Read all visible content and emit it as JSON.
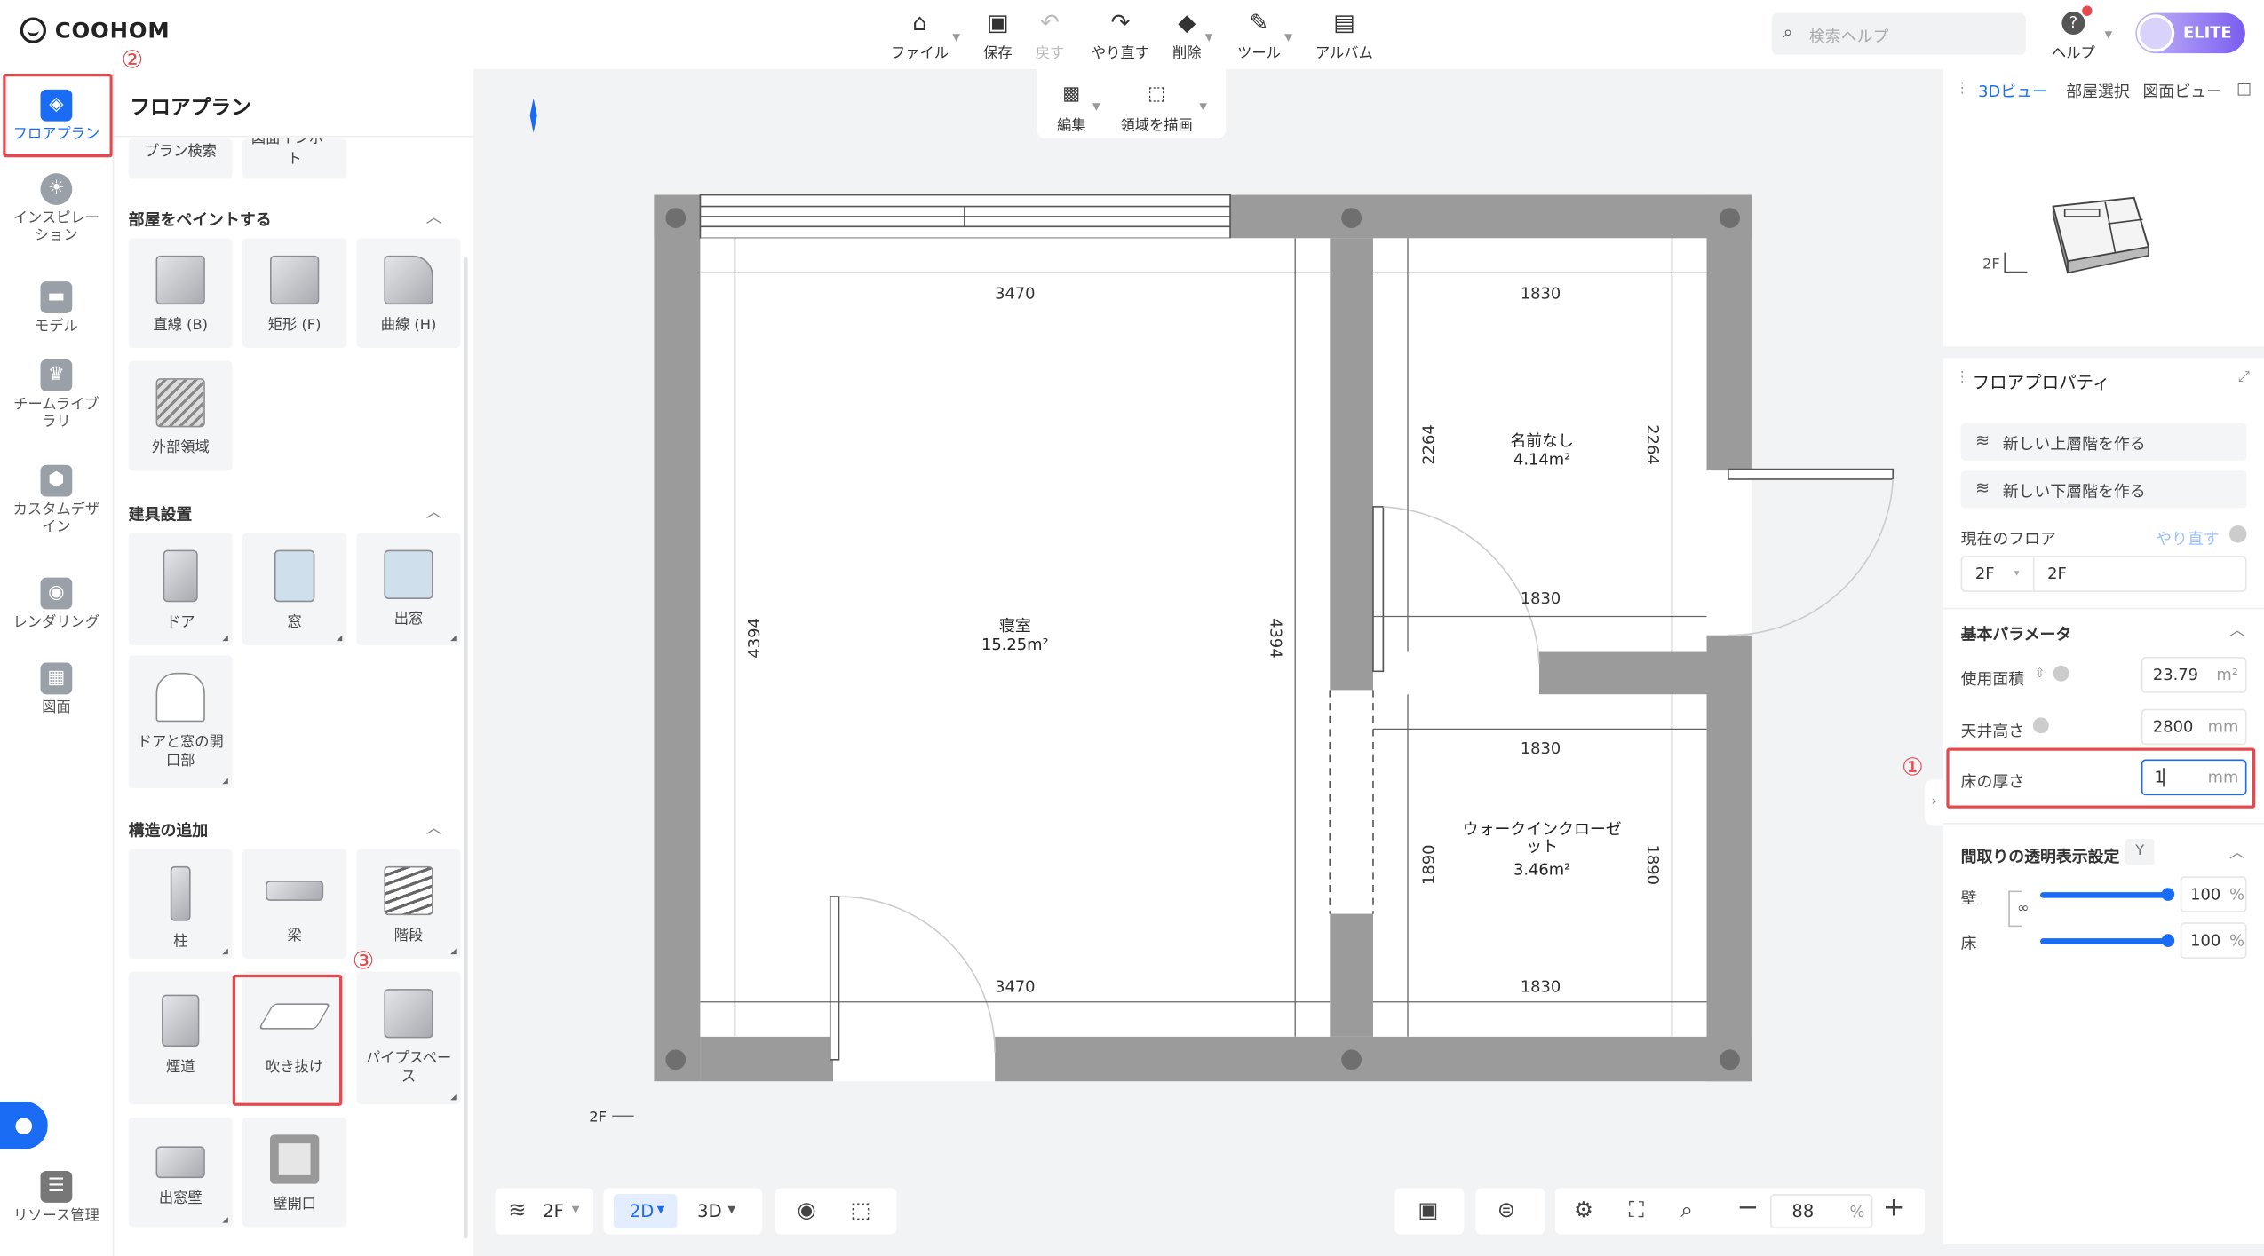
{
  "app": {
    "logo": "COOHOM"
  },
  "toolbar": {
    "items": [
      {
        "label": "ファイル",
        "icon": "home-icon",
        "dropdown": true,
        "disabled": false
      },
      {
        "label": "保存",
        "icon": "save-icon",
        "dropdown": false,
        "disabled": false
      },
      {
        "label": "戻す",
        "icon": "undo-icon",
        "dropdown": false,
        "disabled": true
      },
      {
        "label": "やり直す",
        "icon": "redo-icon",
        "dropdown": false,
        "disabled": false
      },
      {
        "label": "削除",
        "icon": "eraser-icon",
        "dropdown": true,
        "disabled": false
      },
      {
        "label": "ツール",
        "icon": "wrench-icon",
        "dropdown": true,
        "disabled": false
      },
      {
        "label": "アルバム",
        "icon": "album-icon",
        "dropdown": false,
        "disabled": false
      }
    ]
  },
  "search": {
    "placeholder": "検索ヘルプ"
  },
  "help": {
    "label": "ヘルプ"
  },
  "user": {
    "badge": "ELITE"
  },
  "leftnav": {
    "items": [
      {
        "label": "フロアプラン",
        "icon": "floorplan-icon",
        "active": true
      },
      {
        "label": "インスピレーション",
        "icon": "lightbulb-icon",
        "active": false
      },
      {
        "label": "モデル",
        "icon": "sofa-icon",
        "active": false
      },
      {
        "label": "チームライブラリ",
        "icon": "crown-icon",
        "active": false
      },
      {
        "label": "カスタムデザイン",
        "icon": "custom-design-icon",
        "active": false
      },
      {
        "label": "レンダリング",
        "icon": "camera-icon",
        "active": false
      },
      {
        "label": "図面",
        "icon": "drawing-icon",
        "active": false
      },
      {
        "label": "リソース管理",
        "icon": "resource-icon",
        "active": false
      }
    ]
  },
  "panel": {
    "title": "フロアプラン",
    "top_cards": [
      "プラン検索",
      "図面インポート"
    ],
    "sections": [
      {
        "title": "部屋をペイントする",
        "cards": [
          "直線 (B)",
          "矩形 (F)",
          "曲線 (H)",
          "外部領域"
        ]
      },
      {
        "title": "建具設置",
        "cards": [
          "ドア",
          "窓",
          "出窓",
          "ドアと窓の開口部"
        ]
      },
      {
        "title": "構造の追加",
        "cards": [
          "柱",
          "梁",
          "階段",
          "煙道",
          "吹き抜け",
          "パイプスペース",
          "出窓壁",
          "壁開口"
        ]
      }
    ]
  },
  "annotations": {
    "one": "①",
    "two": "②",
    "three": "③"
  },
  "canvas_tools": {
    "edit": "編集",
    "draw_region": "領域を描画"
  },
  "floorplan": {
    "floor_label": "2F",
    "rooms": [
      {
        "name": "寝室",
        "area": "15.25m²"
      },
      {
        "name": "名前なし",
        "area": "4.14m²"
      },
      {
        "name": "ウォークインクローゼット",
        "area": "3.46m²"
      }
    ],
    "dims": {
      "bed_top": "3470",
      "bed_bottom": "3470",
      "bed_left": "4394",
      "bed_right": "4394",
      "top_right_top": "1830",
      "top_right_bottom": "1830",
      "top_right_left": "2264",
      "top_right_right": "2264",
      "wic_top": "1830",
      "wic_bottom": "1830",
      "wic_left": "1890",
      "wic_right": "1890"
    }
  },
  "bottombar": {
    "floor": "2F",
    "mode2d": "2D",
    "mode3d": "3D",
    "zoom": "88",
    "zoom_unit": "%"
  },
  "rightpanel": {
    "tabs": [
      "3Dビュー",
      "部屋選択",
      "図面ビュー"
    ],
    "mini_floor": "2F",
    "title": "フロアプロパティ",
    "new_upper": "新しい上層階を作る",
    "new_lower": "新しい下層階を作る",
    "current_floor_label": "現在のフロア",
    "redo_link": "やり直す",
    "floor_select": "2F",
    "floor_name": "2F",
    "basic_params": "基本パラメータ",
    "area_label": "使用面積",
    "area_value": "23.79",
    "area_unit": "m²",
    "ceiling_label": "天井高さ",
    "ceiling_value": "2800",
    "ceiling_unit": "mm",
    "thickness_label": "床の厚さ",
    "thickness_value": "1",
    "thickness_unit": "mm",
    "transparency_title": "間取りの透明表示設定",
    "transparency_key": "Y",
    "wall_label": "壁",
    "wall_value": "100",
    "floor_label": "床",
    "floor_value": "100",
    "pct": "%",
    "wall_level": 1.0,
    "floor_level": 1.0
  }
}
